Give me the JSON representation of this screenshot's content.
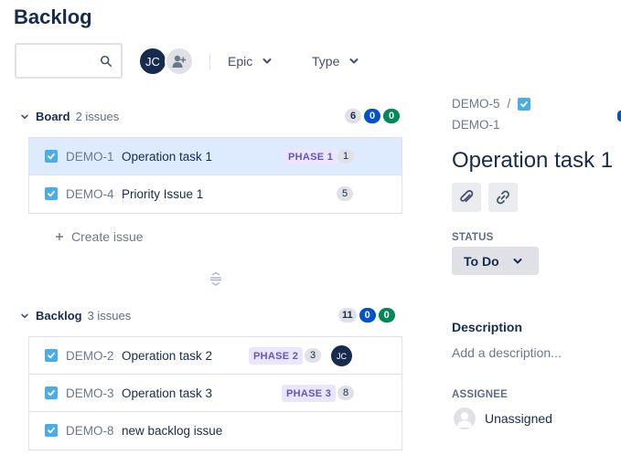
{
  "page": {
    "title": "Backlog"
  },
  "toolbar": {
    "search_value": "",
    "avatar_initials": "JC",
    "epic_filter_label": "Epic",
    "type_filter_label": "Type"
  },
  "board_section": {
    "name": "Board",
    "count_text": "2 issues",
    "badges": {
      "todo": "6",
      "in_progress": "0",
      "done": "0"
    },
    "issues": [
      {
        "key": "DEMO-1",
        "summary": "Operation task 1",
        "epic": "PHASE 1",
        "points": "1",
        "selected": true
      },
      {
        "key": "DEMO-4",
        "summary": "Priority Issue 1",
        "epic": "",
        "points": "5",
        "selected": false
      }
    ],
    "create_issue_label": "Create issue"
  },
  "backlog_section": {
    "name": "Backlog",
    "count_text": "3 issues",
    "badges": {
      "todo": "11",
      "in_progress": "0",
      "done": "0"
    },
    "issues": [
      {
        "key": "DEMO-2",
        "summary": "Operation task 2",
        "epic": "PHASE 2",
        "points": "3",
        "assignee_initials": "JC"
      },
      {
        "key": "DEMO-3",
        "summary": "Operation task 3",
        "epic": "PHASE 3",
        "points": "8"
      },
      {
        "key": "DEMO-8",
        "summary": "new backlog issue",
        "epic": "",
        "points": ""
      }
    ]
  },
  "detail_panel": {
    "parent_key": "DEMO-5",
    "separator": "/",
    "issue_key": "DEMO-1",
    "title": "Operation task 1",
    "status_label": "STATUS",
    "status_value": "To Do",
    "description_heading": "Description",
    "description_placeholder": "Add a description...",
    "assignee_label": "ASSIGNEE",
    "assignee_value": "Unassigned"
  },
  "colors": {
    "primary_text": "#172b4d",
    "subtle_text": "#6b778c",
    "selected_row": "#deebff",
    "task_icon": "#4bade8",
    "epic_text": "#6554c0",
    "epic_bg": "#eae6ff",
    "badge_blue": "#0052cc",
    "badge_green": "#00875a"
  },
  "icons": {
    "search": "search-icon",
    "add_people": "add-people-icon",
    "chevron": "chevron-down-icon",
    "task": "task-checkbox-icon",
    "attach": "paperclip-icon",
    "link": "link-icon",
    "plus": "plus-icon",
    "drag": "drag-handle-icon",
    "unassigned": "user-placeholder-icon"
  }
}
